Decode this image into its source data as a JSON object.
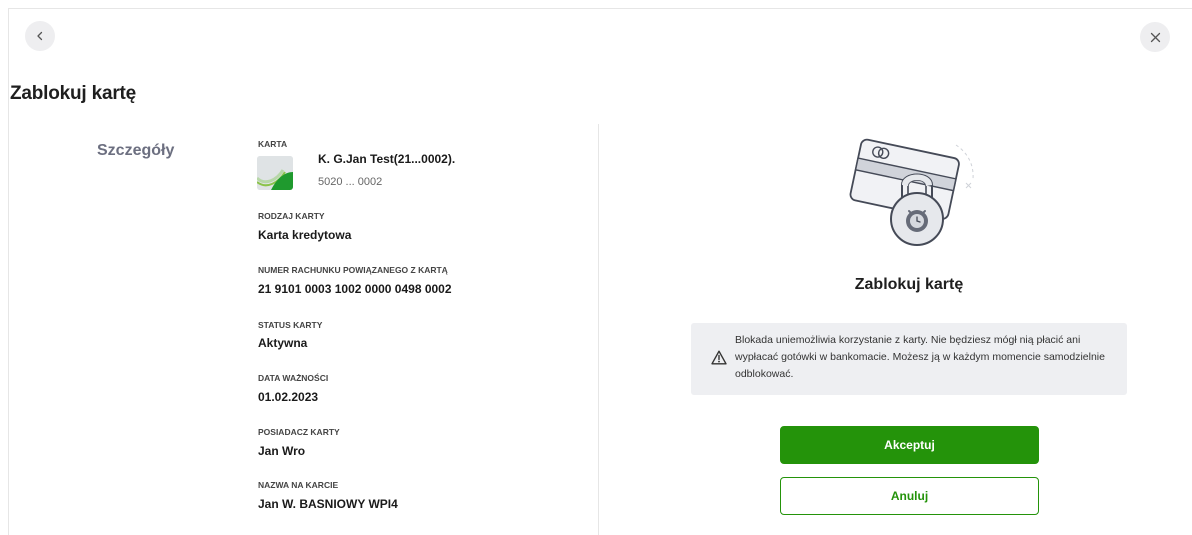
{
  "page": {
    "title": "Zablokuj kartę"
  },
  "navigation": {
    "back_icon": "chevron-left-icon",
    "close_icon": "close-icon"
  },
  "details": {
    "section_title": "Szczegóły",
    "card": {
      "label": "KARTA",
      "name": "K. G.Jan Test(21...0002).",
      "number": "5020 ... 0002"
    },
    "fields": [
      {
        "label": "RODZAJ KARTY",
        "value": "Karta kredytowa"
      },
      {
        "label": "NUMER RACHUNKU POWIĄZANEGO Z KARTĄ",
        "value": "21 9101 0003 1002 0000 0498 0002"
      },
      {
        "label": "STATUS KARTY",
        "value": "Aktywna"
      },
      {
        "label": "DATA WAŻNOŚCI",
        "value": "01.02.2023"
      },
      {
        "label": "POSIADACZ KARTY",
        "value": "Jan Wro"
      },
      {
        "label": "NAZWA NA KARCIE",
        "value": "Jan W. BASNIOWY WPI4"
      }
    ]
  },
  "action_panel": {
    "illustration_icon": "card-lock-icon",
    "title": "Zablokuj kartę",
    "info": {
      "icon": "warning-icon",
      "text": "Blokada uniemożliwia korzystanie z karty. Nie będziesz mógł nią płacić ani wypłacać gotówki w bankomacie. Możesz ją w każdym momencie samodzielnie odblokować."
    },
    "accept_label": "Akceptuj",
    "cancel_label": "Anuluj"
  },
  "colors": {
    "primary": "#24930a",
    "info_bg": "#eeeff2",
    "section_title": "#6c6f80"
  }
}
